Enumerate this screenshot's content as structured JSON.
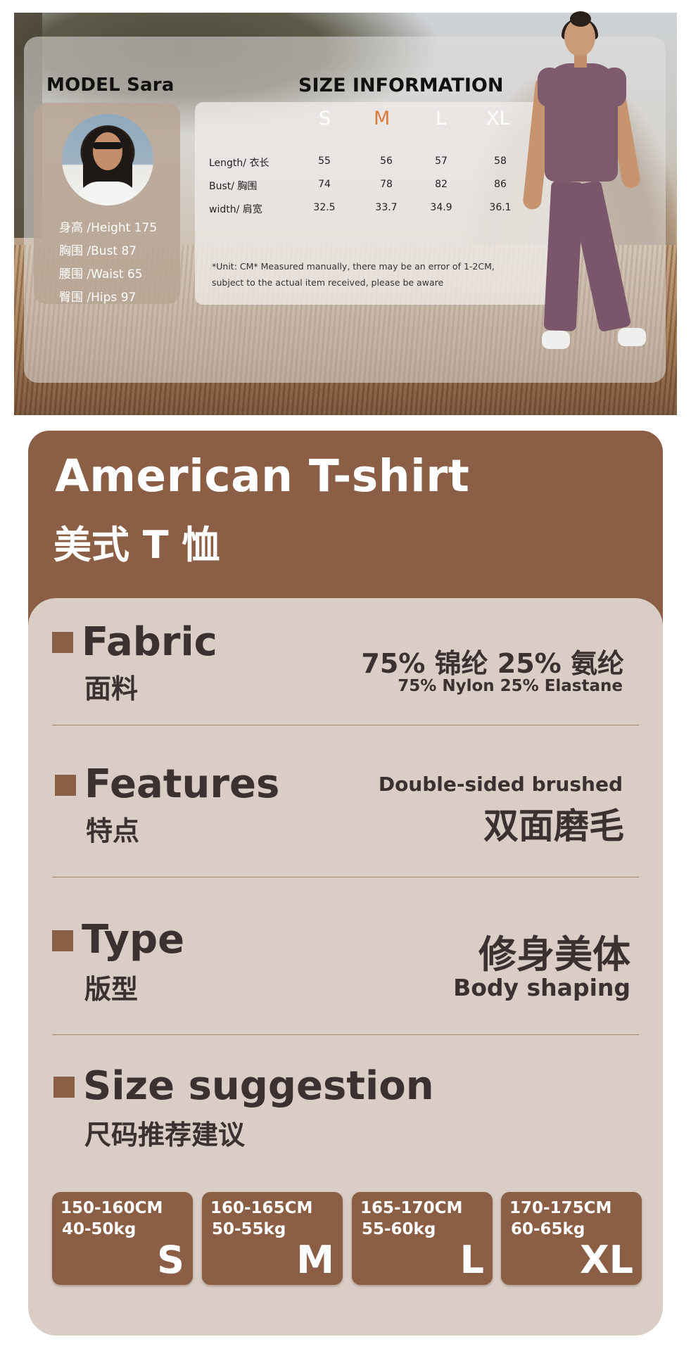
{
  "banner": {
    "model_title": "MODEL Sara",
    "size_title": "SIZE INFORMATION",
    "model_stats": [
      "身高 /Height 175",
      "胸围 /Bust 87",
      "腰围 /Waist 65",
      "臀围 /Hips 97"
    ],
    "size_table": {
      "headers": [
        "S",
        "M",
        "L",
        "XL"
      ],
      "rows": [
        {
          "label": "Length/ 衣长",
          "values": [
            "55",
            "56",
            "57",
            "58"
          ]
        },
        {
          "label": "Bust/ 胸围",
          "values": [
            "74",
            "78",
            "82",
            "86"
          ]
        },
        {
          "label": "width/ 肩宽",
          "values": [
            "32.5",
            "33.7",
            "34.9",
            "36.1"
          ]
        }
      ]
    },
    "note_line1": "*Unit: CM* Measured manually, there may be an error of 1-2CM,",
    "note_line2": "subject to the actual item received, please be aware"
  },
  "product": {
    "title_en": "American T-shirt",
    "title_cn": "美式 T 恤"
  },
  "sections": {
    "fabric": {
      "en": "Fabric",
      "cn": "面料",
      "value_main": "75% 锦纶 25% 氨纶",
      "value_sub": "75% Nylon 25% Elastane"
    },
    "features": {
      "en": "Features",
      "cn": "特点",
      "value_sub": "Double-sided brushed",
      "value_main": "双面磨毛"
    },
    "type": {
      "en": "Type",
      "cn": "版型",
      "value_main": "修身美体",
      "value_sub": "Body shaping"
    },
    "size": {
      "en": "Size suggestion",
      "cn": "尺码推荐建议"
    }
  },
  "size_suggestions": [
    {
      "height": "150-160CM",
      "weight": "40-50kg",
      "size": "S"
    },
    {
      "height": "160-165CM",
      "weight": "50-55kg",
      "size": "M"
    },
    {
      "height": "165-170CM",
      "weight": "55-60kg",
      "size": "L"
    },
    {
      "height": "170-175CM",
      "weight": "60-65kg",
      "size": "XL"
    }
  ],
  "colors": {
    "brown": "#8b5f45",
    "panel": "#d9cdc5",
    "text": "#3a3130",
    "accent_m": "#d97a3e"
  }
}
